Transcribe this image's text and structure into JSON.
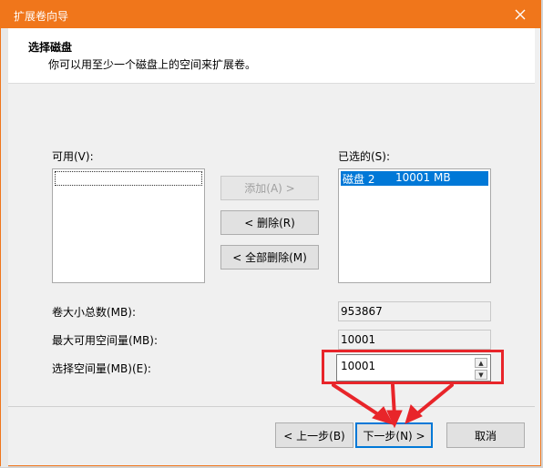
{
  "window": {
    "title": "扩展卷向导"
  },
  "header": {
    "title": "选择磁盘",
    "subtitle": "你可以用至少一个磁盘上的空间来扩展卷。"
  },
  "available": {
    "label": "可用(V):"
  },
  "selected": {
    "label": "已选的(S):",
    "items": [
      {
        "name": "磁盘 2",
        "size": "10001 MB"
      }
    ]
  },
  "actions": {
    "add": "添加(A) >",
    "remove": "< 删除(R)",
    "remove_all": "< 全部删除(M)"
  },
  "fields": {
    "total_label": "卷大小总数(MB):",
    "total_value": "953867",
    "max_label": "最大可用空间量(MB):",
    "max_value": "10001",
    "select_label": "选择空间量(MB)(E):",
    "select_value": "10001"
  },
  "footer": {
    "back": "< 上一步(B)",
    "next": "下一步(N) >",
    "cancel": "取消"
  },
  "colors": {
    "accent": "#f0761b",
    "annotation": "#e8252a",
    "selection": "#0078d7"
  }
}
